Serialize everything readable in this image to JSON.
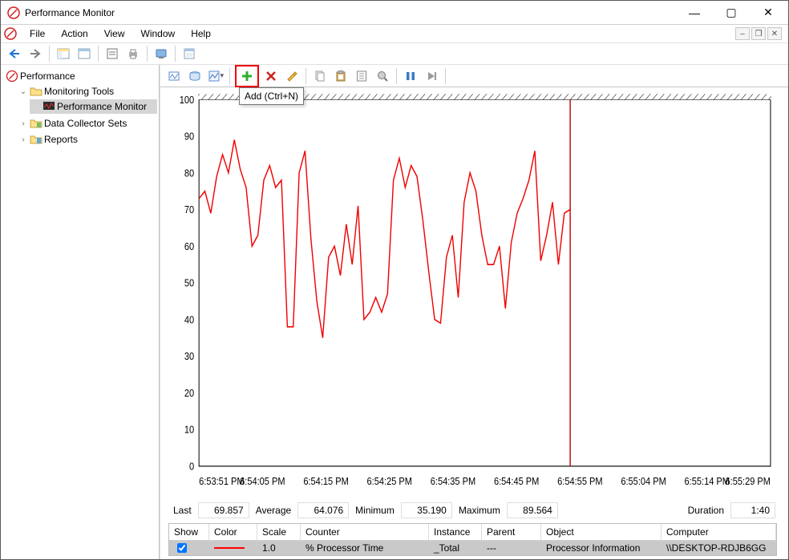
{
  "window": {
    "title": "Performance Monitor",
    "controls": {
      "minimize": "—",
      "maximize": "▢",
      "close": "✕"
    }
  },
  "menu": {
    "items": [
      "File",
      "Action",
      "View",
      "Window",
      "Help"
    ],
    "doc_buttons": {
      "minimize": "–",
      "restore": "❐",
      "close": "✕"
    }
  },
  "tree": {
    "root": "Performance",
    "items": [
      {
        "label": "Monitoring Tools",
        "expanded": true,
        "children": [
          {
            "label": "Performance Monitor",
            "selected": true
          }
        ]
      },
      {
        "label": "Data Collector Sets",
        "expanded": false
      },
      {
        "label": "Reports",
        "expanded": false
      }
    ]
  },
  "inner_toolbar": {
    "tooltip": "Add (Ctrl+N)"
  },
  "chart_data": {
    "type": "line",
    "ylim": [
      0,
      100
    ],
    "yticks": [
      0,
      10,
      20,
      30,
      40,
      50,
      60,
      70,
      80,
      90,
      100
    ],
    "x_labels": [
      "6:53:51 PM",
      "6:54:05 PM",
      "6:54:15 PM",
      "6:54:25 PM",
      "6:54:35 PM",
      "6:54:45 PM",
      "6:54:55 PM",
      "6:55:04 PM",
      "6:55:14 PM",
      "6:55:29 PM"
    ],
    "cursor_index": 45,
    "series": [
      {
        "name": "% Processor Time",
        "color": "#f00000",
        "values": [
          73,
          75,
          69,
          79,
          85,
          80,
          89,
          81,
          76,
          60,
          63,
          78,
          82,
          76,
          78,
          38,
          38,
          80,
          86,
          62,
          45,
          35,
          57,
          60,
          52,
          66,
          55,
          71,
          40,
          42,
          46,
          42,
          47,
          78,
          84,
          76,
          82,
          79,
          67,
          53,
          40,
          39,
          57,
          63,
          46,
          72,
          80,
          75,
          63,
          55,
          55,
          60,
          43,
          61,
          69,
          73,
          78,
          86,
          56,
          63,
          72,
          55,
          69,
          70
        ]
      }
    ]
  },
  "stats": {
    "labels": {
      "last": "Last",
      "average": "Average",
      "minimum": "Minimum",
      "maximum": "Maximum",
      "duration": "Duration"
    },
    "last": "69.857",
    "average": "64.076",
    "minimum": "35.190",
    "maximum": "89.564",
    "duration": "1:40"
  },
  "counters": {
    "headers": [
      "Show",
      "Color",
      "Scale",
      "Counter",
      "Instance",
      "Parent",
      "Object",
      "Computer"
    ],
    "rows": [
      {
        "show": true,
        "scale": "1.0",
        "counter": "% Processor Time",
        "instance": "_Total",
        "parent": "---",
        "object": "Processor Information",
        "computer": "\\\\DESKTOP-RDJB6GG"
      }
    ]
  }
}
